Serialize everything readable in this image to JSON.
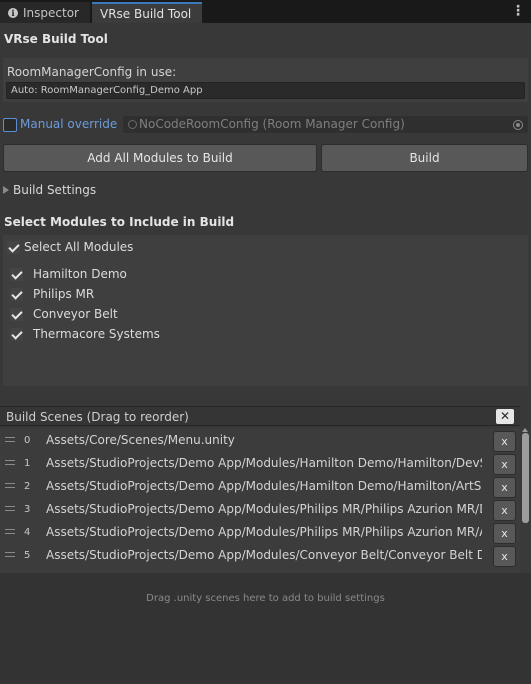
{
  "tabs": [
    {
      "label": "Inspector",
      "icon": "info-icon"
    },
    {
      "label": "VRse Build Tool"
    }
  ],
  "title": "VRse Build Tool",
  "config": {
    "label": "RoomManagerConfig in use:",
    "value": "Auto: RoomManagerConfig_Demo App"
  },
  "override": {
    "label": "Manual override",
    "checked": false,
    "object_field": "NoCodeRoomConfig (Room Manager Config)"
  },
  "buttons": {
    "add_all": "Add All Modules to Build",
    "build": "Build"
  },
  "build_settings": "Build Settings",
  "modules_title": "Select Modules to Include in Build",
  "select_all": "Select All Modules",
  "modules": [
    "Hamilton Demo",
    "Philips MR",
    "Conveyor Belt",
    "Thermacore Systems"
  ],
  "scenes": {
    "header": "Build Scenes (Drag to reorder)",
    "clear_label": "✕",
    "remove_label": "x",
    "rows": [
      {
        "index": "0",
        "path": "Assets/Core/Scenes/Menu.unity"
      },
      {
        "index": "1",
        "path": "Assets/StudioProjects/Demo App/Modules/Hamilton Demo/Hamilton/DevScene"
      },
      {
        "index": "2",
        "path": "Assets/StudioProjects/Demo App/Modules/Hamilton Demo/Hamilton/ArtScene"
      },
      {
        "index": "3",
        "path": "Assets/StudioProjects/Demo App/Modules/Philips MR/Philips Azurion MR/DevScene"
      },
      {
        "index": "4",
        "path": "Assets/StudioProjects/Demo App/Modules/Philips MR/Philips Azurion MR/ArtScene"
      },
      {
        "index": "5",
        "path": "Assets/StudioProjects/Demo App/Modules/Conveyor Belt/Conveyor Belt Demo"
      }
    ]
  },
  "drop_hint": "Drag .unity scenes here to add to build settings",
  "colors": {
    "background": "#383838",
    "accent": "#3a79bb",
    "link": "#6d9bda"
  }
}
